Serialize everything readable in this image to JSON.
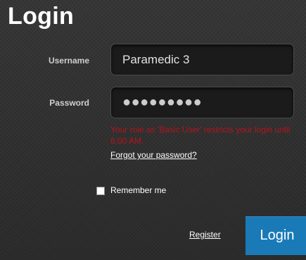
{
  "header": {
    "title": "Login"
  },
  "form": {
    "username_label": "Username",
    "username_value": "Paramedic 3",
    "password_label": "Password",
    "password_mask": "●●●●●●●●●",
    "error_message": "Your role as 'Basic User' restricts your login until 6:00 AM.",
    "forgot_password": "Forgot your password?",
    "remember_me": "Remember me",
    "remember_checked": false,
    "register_link": "Register",
    "login_button": "Login"
  }
}
